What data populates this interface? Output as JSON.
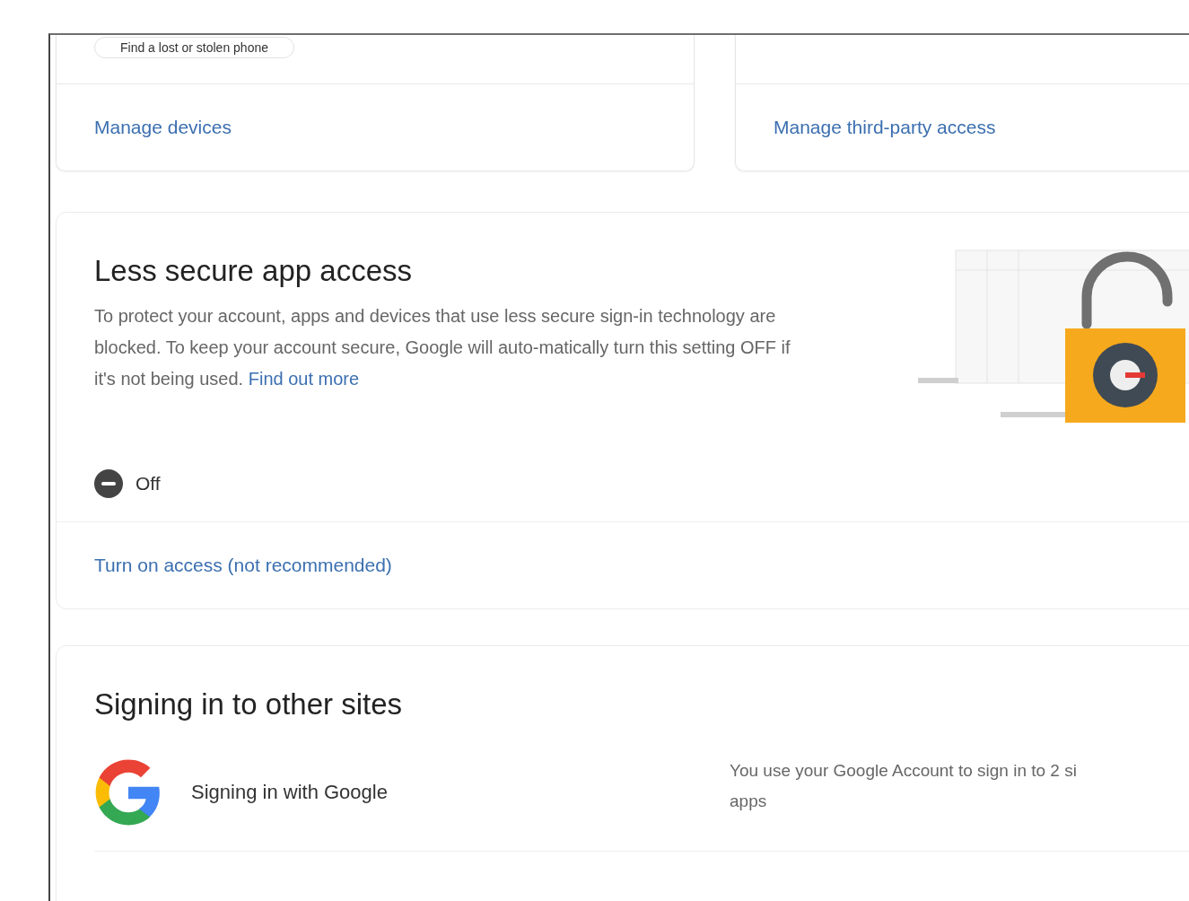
{
  "devices_card": {
    "button": "Find a lost or stolen phone",
    "link": "Manage devices"
  },
  "third_party_card": {
    "link": "Manage third-party access"
  },
  "less_secure": {
    "title": "Less secure app access",
    "description": "To protect your account, apps and devices that use less secure sign-in technology are blocked. To keep your account secure, Google will auto-matically turn this setting OFF if it's not being used.",
    "learn_link": "Find out more",
    "status": {
      "kind": "off",
      "label": "Off"
    },
    "action_link": "Turn on access (not recommended)"
  },
  "other_sites": {
    "title": "Signing in to other sites",
    "rows": [
      {
        "label": "Signing in with Google",
        "description_lines": [
          "You use your Google Account to sign in to 2 si",
          "apps"
        ]
      }
    ]
  }
}
